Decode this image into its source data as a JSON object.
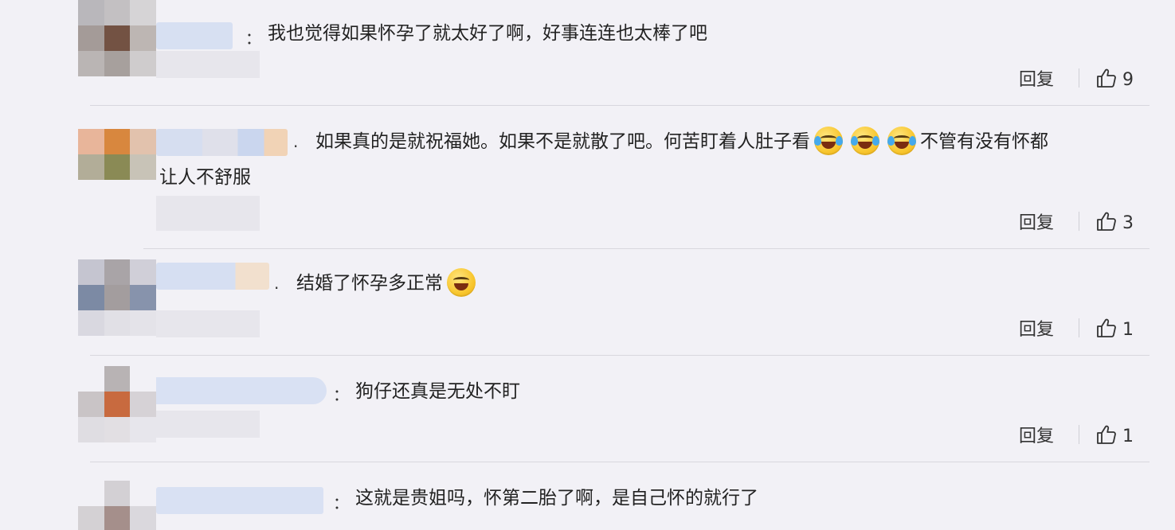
{
  "colors": {
    "background": "#f2f1f6",
    "text": "#222222",
    "divider": "#d8d7de"
  },
  "comments": [
    {
      "separator": "：",
      "segments": [
        "我也觉得如果怀孕了就太好了啊，好事连连也太棒了吧"
      ],
      "reply_label": "回复",
      "likes": "9",
      "emoji_icon": null
    },
    {
      "separator": ".",
      "segments": [
        "如果真的是就祝福她。如果不是就散了吧。何苦盯着人肚子看",
        "不管有没有怀都",
        "让人不舒服"
      ],
      "reply_label": "回复",
      "likes": "3",
      "emoji_icon": "crying-laughing-face-icon"
    },
    {
      "separator": ".",
      "segments": [
        "结婚了怀孕多正常"
      ],
      "reply_label": "回复",
      "likes": "1",
      "emoji_icon": "grinning-face-icon"
    },
    {
      "separator": "：",
      "segments": [
        "狗仔还真是无处不盯"
      ],
      "reply_label": "回复",
      "likes": "1",
      "emoji_icon": null
    },
    {
      "separator": "：",
      "segments": [
        "这就是贵姐吗，怀第二胎了啊，是自己怀的就行了"
      ],
      "reply_label": null,
      "likes": null,
      "emoji_icon": null
    }
  ]
}
